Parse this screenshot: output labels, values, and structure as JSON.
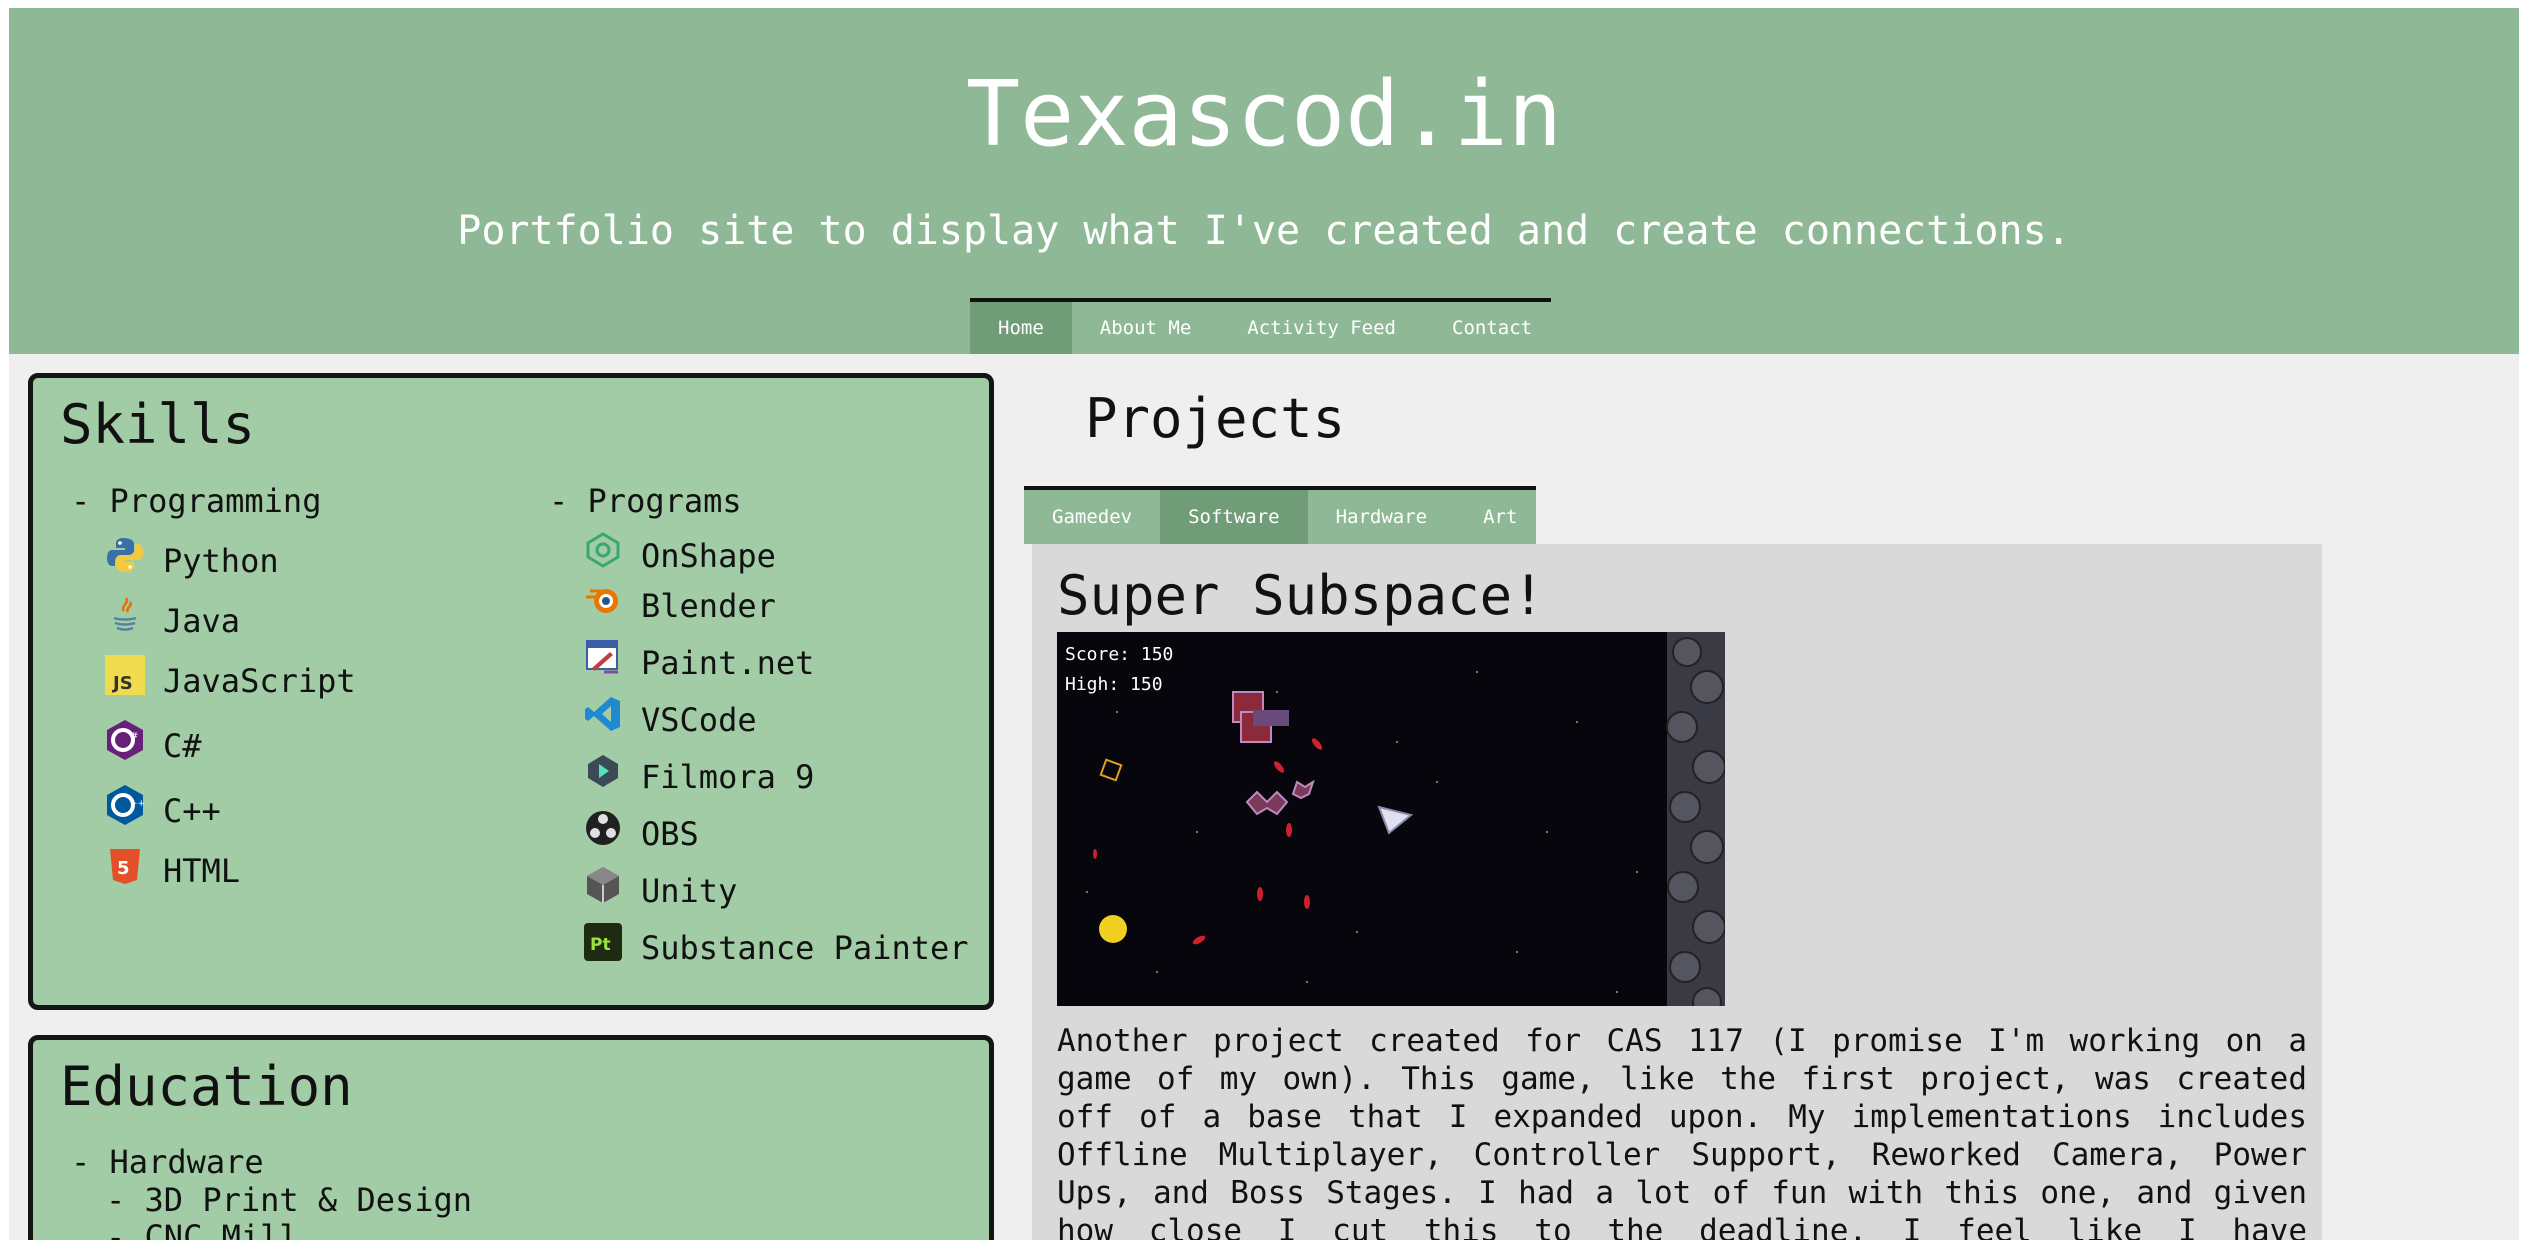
{
  "header": {
    "title": "Texascod.in",
    "tagline": "Portfolio site to display what I've created and create connections."
  },
  "nav": {
    "items": [
      {
        "label": "Home",
        "active": true
      },
      {
        "label": "About Me",
        "active": false
      },
      {
        "label": "Activity Feed",
        "active": false
      },
      {
        "label": "Contact",
        "active": false
      }
    ]
  },
  "skills": {
    "title": "Skills",
    "programming": {
      "heading": "- Programming",
      "items": [
        {
          "label": "Python",
          "icon": "python-icon"
        },
        {
          "label": "Java",
          "icon": "java-icon"
        },
        {
          "label": "JavaScript",
          "icon": "javascript-icon"
        },
        {
          "label": "C#",
          "icon": "csharp-icon"
        },
        {
          "label": "C++",
          "icon": "cplusplus-icon"
        },
        {
          "label": "HTML",
          "icon": "html5-icon"
        }
      ]
    },
    "programs": {
      "heading": "- Programs",
      "items": [
        {
          "label": "OnShape",
          "icon": "onshape-icon"
        },
        {
          "label": "Blender",
          "icon": "blender-icon"
        },
        {
          "label": "Paint.net",
          "icon": "paintnet-icon"
        },
        {
          "label": "VSCode",
          "icon": "vscode-icon"
        },
        {
          "label": "Filmora 9",
          "icon": "filmora-icon"
        },
        {
          "label": "OBS",
          "icon": "obs-icon"
        },
        {
          "label": "Unity",
          "icon": "unity-icon"
        },
        {
          "label": "Substance Painter",
          "icon": "substance-painter-icon"
        }
      ]
    }
  },
  "education": {
    "title": "Education",
    "lines": [
      "- Hardware",
      "- 3D Print & Design",
      "- CNC Mill"
    ]
  },
  "projects": {
    "title": "Projects",
    "tabs": [
      {
        "label": "Gamedev",
        "active": false
      },
      {
        "label": "Software",
        "active": true
      },
      {
        "label": "Hardware",
        "active": false
      },
      {
        "label": "Art",
        "active": false
      }
    ],
    "card": {
      "title": "Super Subspace!",
      "screenshot": {
        "score": "Score: 150",
        "high": "High: 150"
      },
      "description": "Another project created for CAS 117 (I promise I'm working on a game of my own). This game, like the first project, was created off of a base that I expanded upon. My implementations includes Offline Multiplayer, Controller Support, Reworked Camera, Power Ups, and Boss Stages. I had a lot of fun with this one, and given how close I cut this to the deadline, I feel like I have experienced crunch"
    }
  },
  "colors": {
    "header_green": "#8fb996",
    "active_green": "#719c78",
    "panel_green": "#a1cca5",
    "card_gray": "#d9d9d9"
  }
}
